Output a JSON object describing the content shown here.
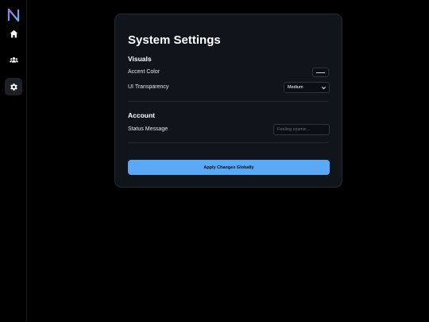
{
  "sidebar": {
    "logo_icon": "n-logo-icon",
    "nav": [
      {
        "id": "home",
        "icon": "home-icon"
      },
      {
        "id": "users",
        "icon": "users-icon"
      },
      {
        "id": "settings",
        "icon": "gear-icon",
        "active": true
      }
    ]
  },
  "panel": {
    "title": "System Settings",
    "visuals": {
      "heading": "Visuals",
      "accent_label": "Accent Color",
      "transparency_label": "UI Transparency",
      "transparency_value": "Medium"
    },
    "account": {
      "heading": "Account",
      "status_label": "Status Message",
      "status_placeholder": "Feeling cosmic..."
    },
    "apply_label": "Apply Changes Globally"
  },
  "colors": {
    "accent": "#5aa9f7",
    "panel_bg": "#10141b",
    "page_bg": "#000000"
  }
}
